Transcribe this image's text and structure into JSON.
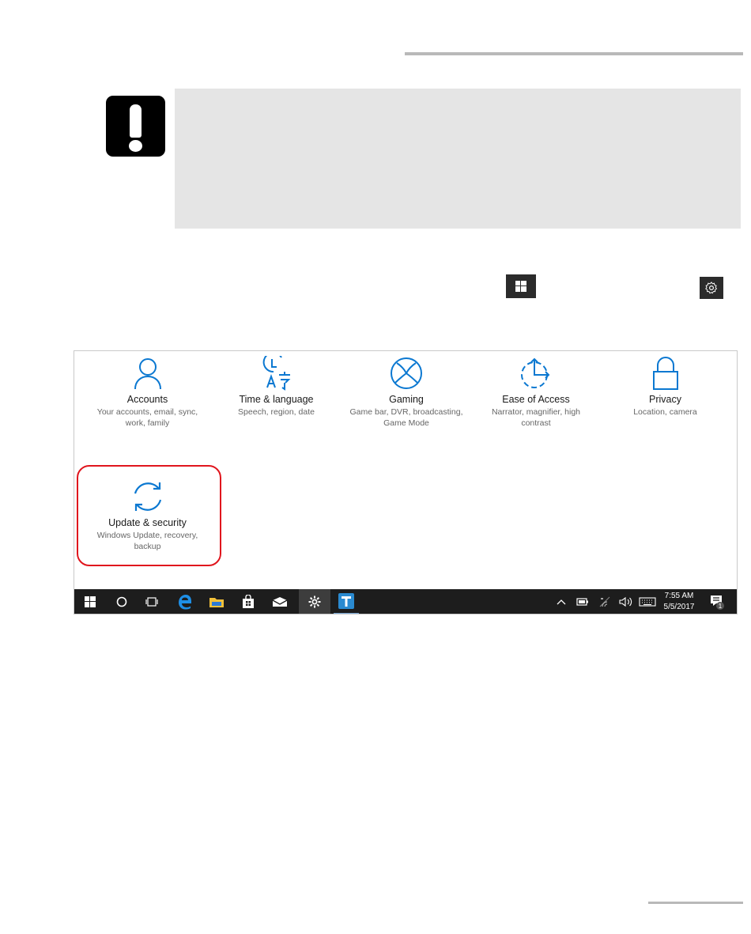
{
  "settings": {
    "tiles": [
      {
        "title": "Accounts",
        "subtitle": "Your accounts, email, sync, work, family",
        "icon": "person-icon"
      },
      {
        "title": "Time & language",
        "subtitle": "Speech, region, date",
        "icon": "time-language-icon"
      },
      {
        "title": "Gaming",
        "subtitle": "Game bar, DVR, broadcasting, Game Mode",
        "icon": "xbox-icon"
      },
      {
        "title": "Ease of Access",
        "subtitle": "Narrator, magnifier, high contrast",
        "icon": "ease-of-access-icon"
      },
      {
        "title": "Privacy",
        "subtitle": "Location, camera",
        "icon": "lock-icon"
      },
      {
        "title": "Update & security",
        "subtitle": "Windows Update, recovery, backup",
        "icon": "sync-icon"
      }
    ]
  },
  "taskbar": {
    "time": "7:55 AM",
    "date": "5/5/2017",
    "notification_count": "1"
  },
  "colors": {
    "accent": "#0b78d1",
    "highlight": "#e0151d",
    "taskbar": "#1d1d1d",
    "note_background": "#e5e5e5"
  }
}
